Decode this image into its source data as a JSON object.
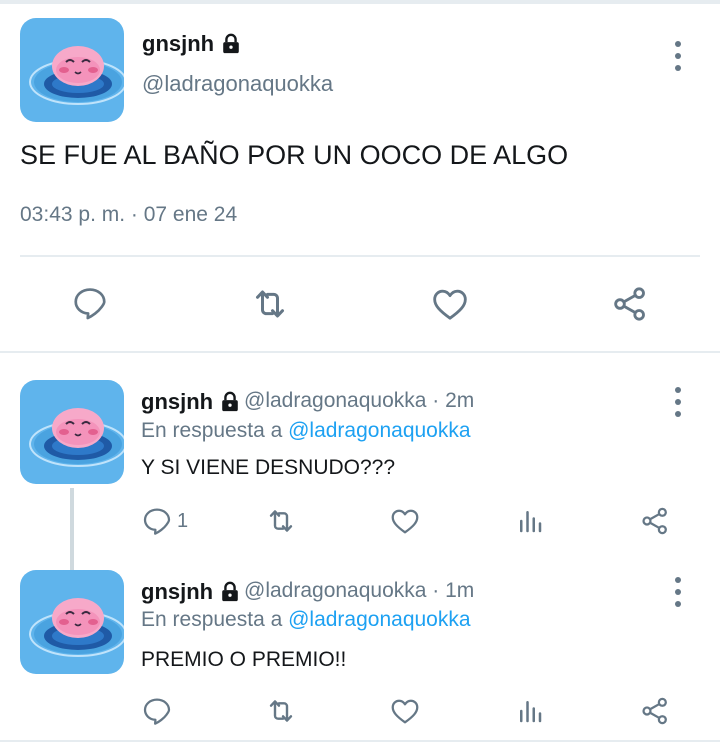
{
  "main_tweet": {
    "display_name": "gnsjnh",
    "handle": "@ladragonaquokka",
    "text": "SE FUE AL BAÑO POR UN OOCO DE ALGO",
    "timestamp": "03:43 p. m. · 07 ene 24",
    "icons": [
      "lock-icon",
      "more-icon",
      "reply-icon",
      "retweet-icon",
      "like-icon",
      "share-icon"
    ]
  },
  "replies": [
    {
      "display_name": "gnsjnh",
      "handle_time": "@ladragonaquokka · 2m",
      "reply_prefix": "En respuesta a ",
      "reply_mention": "@ladragonaquokka",
      "text": "Y SI VIENE DESNUDO???",
      "reply_count": "1"
    },
    {
      "display_name": "gnsjnh",
      "handle_time": "@ladragonaquokka · 1m",
      "reply_prefix": "En respuesta a ",
      "reply_mention": "@ladragonaquokka",
      "text": "PREMIO O PREMIO!!",
      "reply_count": ""
    }
  ],
  "colors": {
    "accent": "#1da1f2",
    "secondary_text": "#657786",
    "divider": "#e6ecf0"
  }
}
